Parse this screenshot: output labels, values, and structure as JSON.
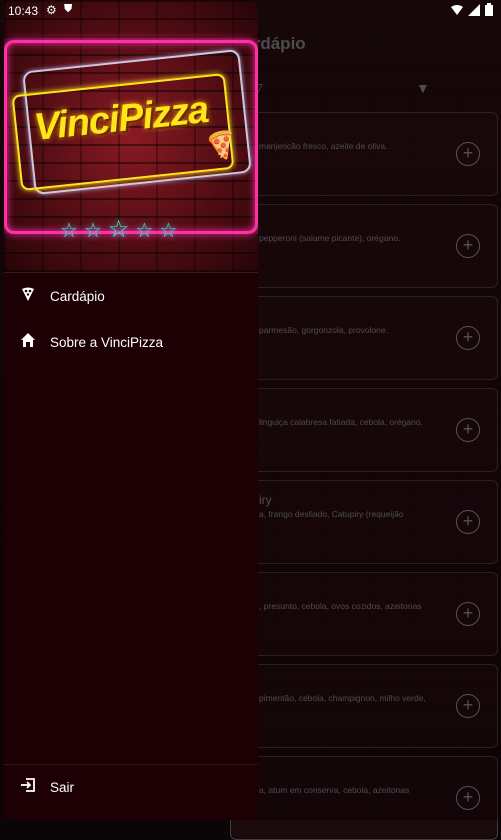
{
  "status_bar": {
    "time": "10:43",
    "icons": [
      "gear-icon",
      "shield-icon",
      "wifi-icon",
      "signal-icon",
      "battery-icon"
    ]
  },
  "background_app": {
    "title": "Cardápio",
    "cards": [
      {
        "name": "",
        "desc": "manjericão fresco, azeite de oliva."
      },
      {
        "name": "",
        "desc": "pepperoni (salame picante), orégano."
      },
      {
        "name": "",
        "desc": "parmesão, gorgonzola, provolone."
      },
      {
        "name": "",
        "desc": "linguiça calabresa fatiada, cebola, orégano."
      },
      {
        "name": "iry",
        "desc": "a, frango desfiado, Catupiry (requeijão"
      },
      {
        "name": "",
        "desc": ", presunto, cebola, ovos cozidos, azeitonas"
      },
      {
        "name": "",
        "desc": "pimentão, cebola, champignon, milho verde,"
      },
      {
        "name": "",
        "desc": "a, atum em conserva, cebola, azeitonas"
      }
    ]
  },
  "drawer": {
    "logo_text": "VinciPizza",
    "menu": [
      {
        "icon": "pizza-slice-icon",
        "label": "Cardápio"
      },
      {
        "icon": "home-icon",
        "label": "Sobre a VinciPizza"
      }
    ],
    "logout": {
      "icon": "logout-icon",
      "label": "Sair"
    }
  },
  "colors": {
    "drawer_bg": "#1c0003",
    "neon_pink": "#ff2fa6",
    "neon_yellow": "#ffe51a",
    "neon_cyan": "#2ff2e6"
  }
}
